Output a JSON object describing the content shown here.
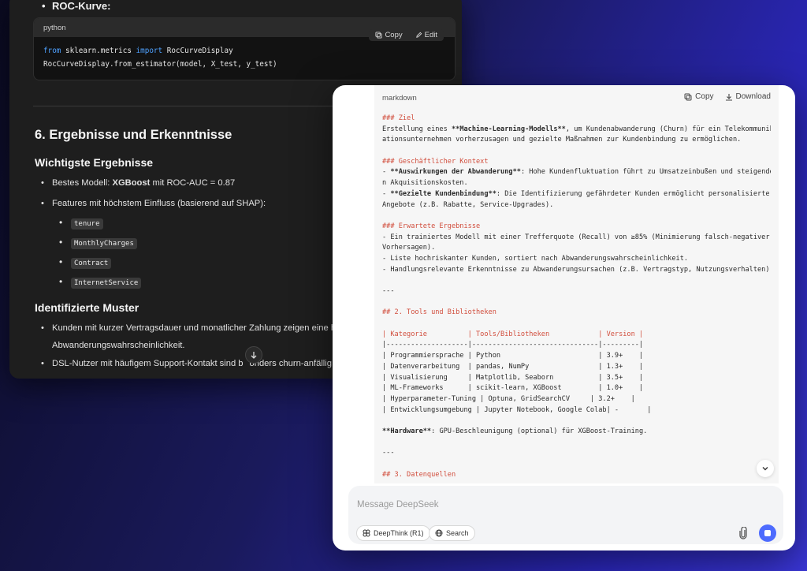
{
  "dark": {
    "top_bullet": "ROC-Kurve:",
    "code": {
      "lang": "python",
      "copy_label": "Copy",
      "edit_label": "Edit",
      "line1": [
        "from",
        " sklearn.metrics ",
        "import",
        " RocCurveDisplay"
      ],
      "line2": "RocCurveDisplay.from_estimator(model, X_test, y_test)"
    },
    "heading": "6. Ergebnisse und Erkenntnisse",
    "sub1": "Wichtigste Ergebnisse",
    "item1_prefix": "Bestes Modell: ",
    "item1_bold": "XGBoost",
    "item1_suffix": " mit ROC-AUC = 0.87",
    "item2": "Features mit höchstem Einfluss (basierend auf SHAP):",
    "features": [
      "tenure",
      "MonthlyCharges",
      "Contract",
      "InternetService"
    ],
    "sub2": "Identifizierte Muster",
    "pattern1_a": "Kunden mit kurzer Vertragsdauer und monatlicher Zahlung zeigen eine h",
    "pattern1_b": "Abwanderungswahrscheinlichkeit.",
    "pattern2_a": "DSL-Nutzer mit häufigem Support-Kontakt sind b",
    "pattern2_b": "onders churn-anfällig"
  },
  "light": {
    "lang": "markdown",
    "copy_label": "Copy",
    "download_label": "Download",
    "lines": [
      [
        [
          "r",
          "### Ziel"
        ]
      ],
      [
        [
          "n",
          "Erstellung eines "
        ],
        [
          "b",
          "**Machine-Learning-Modells**"
        ],
        [
          "n",
          ", um Kundenabwanderung (Churn) für ein Telekommunik"
        ]
      ],
      [
        [
          "n",
          "ationsunternehmen vorherzusagen und gezielte Maßnahmen zur Kundenbindung zu ermöglichen."
        ]
      ],
      [
        [
          "n",
          ""
        ]
      ],
      [
        [
          "r",
          "### Geschäftlicher Kontext"
        ]
      ],
      [
        [
          "n",
          "- "
        ],
        [
          "b",
          "**Auswirkungen der Abwanderung**"
        ],
        [
          "n",
          ": Hohe Kundenfluktuation führt zu Umsatzeinbußen und steigende"
        ]
      ],
      [
        [
          "n",
          "n Akquisitionskosten."
        ]
      ],
      [
        [
          "n",
          "- "
        ],
        [
          "b",
          "**Gezielte Kundenbindung**"
        ],
        [
          "n",
          ": Die Identifizierung gefährdeter Kunden ermöglicht personalisierte"
        ]
      ],
      [
        [
          "n",
          "Angebote (z.B. Rabatte, Service-Upgrades)."
        ]
      ],
      [
        [
          "n",
          ""
        ]
      ],
      [
        [
          "r",
          "### Erwartete Ergebnisse"
        ]
      ],
      [
        [
          "n",
          "- Ein trainiertes Modell mit einer Trefferquote (Recall) von ≥85% (Minimierung falsch-negativer"
        ]
      ],
      [
        [
          "n",
          "Vorhersagen)."
        ]
      ],
      [
        [
          "n",
          "- Liste hochriskanter Kunden, sortiert nach Abwanderungswahrscheinlichkeit."
        ]
      ],
      [
        [
          "n",
          "- Handlungsrelevante Erkenntnisse zu Abwanderungsursachen (z.B. Vertragstyp, Nutzungsverhalten)."
        ]
      ],
      [
        [
          "n",
          ""
        ]
      ],
      [
        [
          "n",
          "---"
        ]
      ],
      [
        [
          "n",
          ""
        ]
      ],
      [
        [
          "r",
          "## 2. Tools und Bibliotheken"
        ]
      ],
      [
        [
          "n",
          ""
        ]
      ],
      [
        [
          "r",
          "| Kategorie          | Tools/Bibliotheken            | Version |"
        ]
      ],
      [
        [
          "n",
          "|--------------------|-------------------------------|---------|"
        ]
      ],
      [
        [
          "n",
          "| Programmiersprache | Python                        | 3.9+    |"
        ]
      ],
      [
        [
          "n",
          "| Datenverarbeitung  | pandas, NumPy                 | 1.3+    |"
        ]
      ],
      [
        [
          "n",
          "| Visualisierung     | Matplotlib, Seaborn           | 3.5+    |"
        ]
      ],
      [
        [
          "n",
          "| ML-Frameworks      | scikit-learn, XGBoost         | 1.0+    |"
        ]
      ],
      [
        [
          "n",
          "| Hyperparameter-Tuning | Optuna, GridSearchCV     | 3.2+    |"
        ]
      ],
      [
        [
          "n",
          "| Entwicklungsumgebung | Jupyter Notebook, Google Colab| -       |"
        ]
      ],
      [
        [
          "n",
          ""
        ]
      ],
      [
        [
          "b",
          "**Hardware**"
        ],
        [
          "n",
          ": GPU-Beschleunigung (optional) für XGBoost-Training."
        ]
      ],
      [
        [
          "n",
          ""
        ]
      ],
      [
        [
          "n",
          "---"
        ]
      ],
      [
        [
          "n",
          ""
        ]
      ],
      [
        [
          "r",
          "## 3. Datenquellen"
        ]
      ]
    ],
    "input_placeholder": "Message DeepSeek",
    "deepthink_label": "DeepThink (R1)",
    "search_label": "Search"
  },
  "icons": [
    "copy-icon",
    "edit-icon",
    "download-icon",
    "chevron-down-icon",
    "arrow-down-icon",
    "deepthink-icon",
    "globe-icon",
    "paperclip-icon",
    "stop-icon"
  ]
}
